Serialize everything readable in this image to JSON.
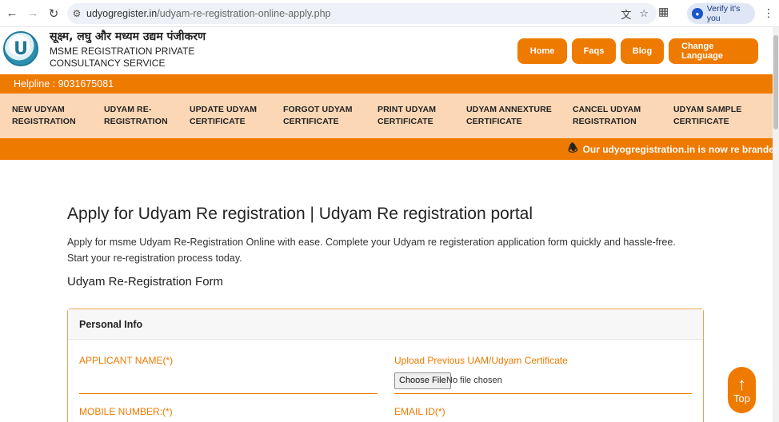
{
  "browser": {
    "url_host": "udyogregister.in",
    "url_path": "/udyam-re-registration-online-apply.php",
    "verify_label": "Verify it's you"
  },
  "header": {
    "brand_hindi": "सूक्ष्म, लघु और मध्यम उद्यम पंजीकरण",
    "brand_line1": "MSME REGISTRATION PRIVATE",
    "brand_line2": "CONSULTANCY SERVICE",
    "buttons": [
      "Home",
      "Faqs",
      "Blog",
      "Change Language"
    ]
  },
  "helpline": "Helpline : 9031675081",
  "menu": [
    {
      "line1": "NEW UDYAM",
      "line2": "REGISTRATION"
    },
    {
      "line1": "UDYAM RE-",
      "line2": "REGISTRATION"
    },
    {
      "line1": "UPDATE UDYAM",
      "line2": "CERTIFICATE"
    },
    {
      "line1": "FORGOT UDYAM",
      "line2": "CERTIFICATE"
    },
    {
      "line1": "PRINT UDYAM",
      "line2": "CERTIFICATE"
    },
    {
      "line1": "UDYAM ANNEXTURE",
      "line2": "CERTIFICATE"
    },
    {
      "line1": "CANCEL UDYAM",
      "line2": "REGISTRATION"
    },
    {
      "line1": "UDYAM SAMPLE",
      "line2": "CERTIFICATE"
    }
  ],
  "ticker": "Our udyogregistration.in is now re branded to",
  "main": {
    "title": "Apply for Udyam Re registration | Udyam Re registration portal",
    "intro": "Apply for msme Udyam Re-Registration Online with ease. Complete your Udyam re registeration application form quickly and hassle-free. Start your re-registration process today.",
    "form_title": "Udyam Re-Registration Form"
  },
  "form": {
    "section": "Personal Info",
    "applicant_name_label": "APPLICANT NAME(*)",
    "upload_label": "Upload Previous UAM/Udyam Certificate",
    "choose_file": "Choose File",
    "file_status": "No file chosen",
    "mobile_label": "MOBILE NUMBER:(*)",
    "email_label": "EMAIL ID(*)"
  },
  "top_button": "Top",
  "colors": {
    "accent": "#ee7a00",
    "menu_bg": "#fbd7b5"
  },
  "icons": [
    "back-icon",
    "forward-icon",
    "reload-icon",
    "site-info-icon",
    "translate-icon",
    "star-icon",
    "extensions-icon",
    "menu-icon",
    "bell-icon",
    "arrow-up-icon"
  ]
}
